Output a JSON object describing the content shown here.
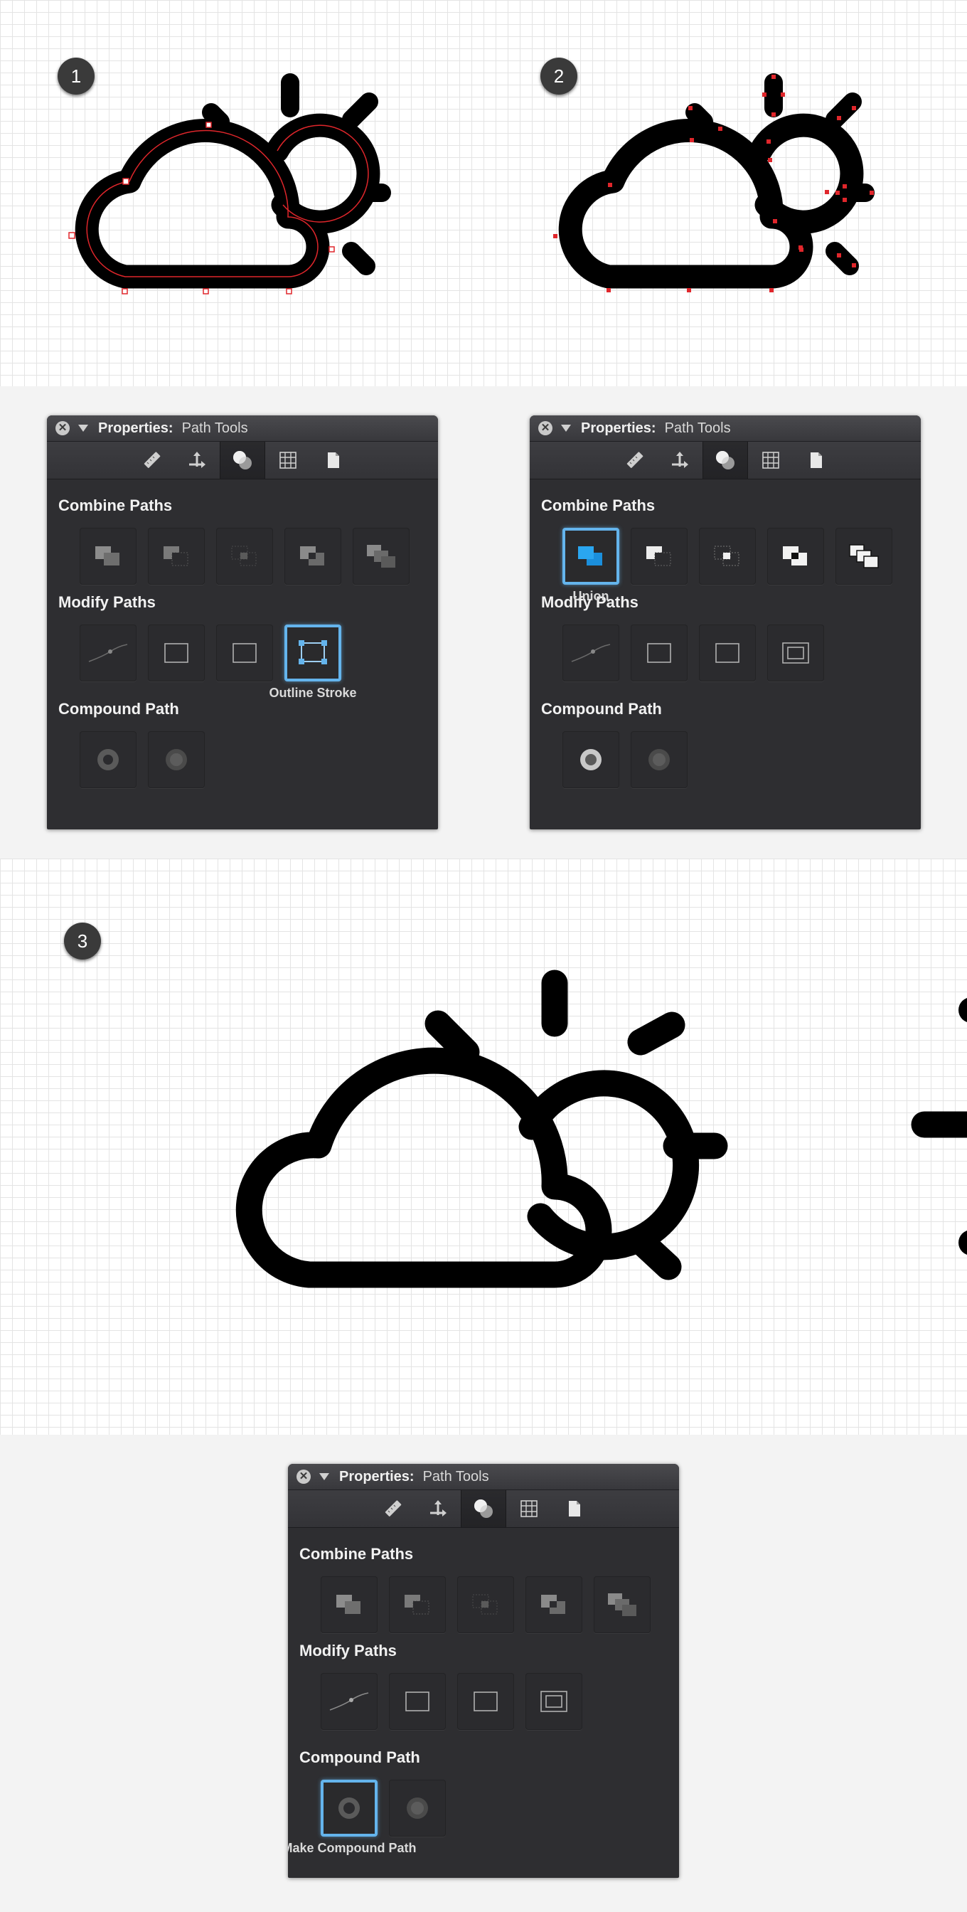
{
  "steps": [
    {
      "number": "1"
    },
    {
      "number": "2"
    },
    {
      "number": "3"
    }
  ],
  "panels": [
    {
      "title_bold": "Properties:",
      "title_light": "Path Tools",
      "toolbar_icons": [
        "ruler-icon",
        "move-icon",
        "path-ops-icon",
        "grid-icon",
        "document-icon"
      ],
      "active_tool": "path-ops-icon",
      "sections": {
        "combine": "Combine Paths",
        "modify": "Modify Paths",
        "compound": "Compound Path"
      },
      "selected_button": "outline-stroke",
      "selected_label": "Outline Stroke"
    },
    {
      "title_bold": "Properties:",
      "title_light": "Path Tools",
      "toolbar_icons": [
        "ruler-icon",
        "move-icon",
        "path-ops-icon",
        "grid-icon",
        "document-icon"
      ],
      "active_tool": "path-ops-icon",
      "sections": {
        "combine": "Combine Paths",
        "modify": "Modify Paths",
        "compound": "Compound Path"
      },
      "selected_button": "union",
      "selected_label": "Union"
    },
    {
      "title_bold": "Properties:",
      "title_light": "Path Tools",
      "toolbar_icons": [
        "ruler-icon",
        "move-icon",
        "path-ops-icon",
        "grid-icon",
        "document-icon"
      ],
      "active_tool": "path-ops-icon",
      "sections": {
        "combine": "Combine Paths",
        "modify": "Modify Paths",
        "compound": "Compound Path"
      },
      "selected_button": "make-compound-path",
      "selected_label": "Make Compound Path"
    }
  ],
  "colors": {
    "selection_blue": "#64b4ec",
    "anchor_red": "#e0262b",
    "union_blue": "#2aa6f0"
  }
}
